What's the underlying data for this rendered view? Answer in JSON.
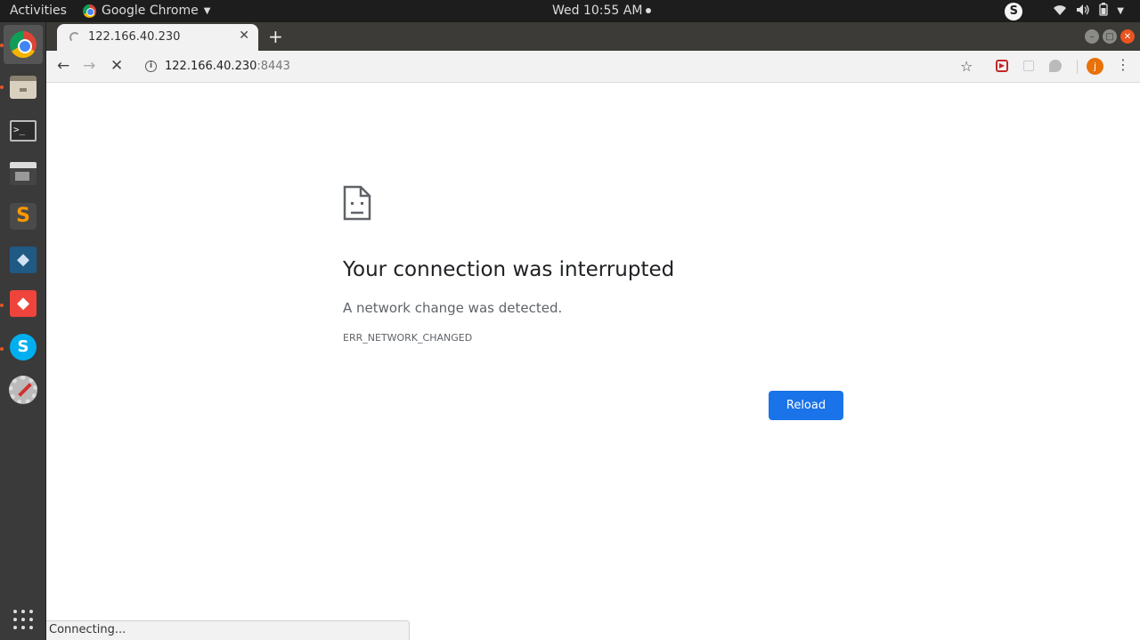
{
  "topbar": {
    "activities": "Activities",
    "app_name": "Google Chrome",
    "clock": "Wed 10:55 AM"
  },
  "browser": {
    "tab_title": "122.166.40.230",
    "url_host": "122.166.40.230",
    "url_port": ":8443",
    "profile_initial": "j"
  },
  "error_page": {
    "title": "Your connection was interrupted",
    "description": "A network change was detected.",
    "code": "ERR_NETWORK_CHANGED",
    "reload_label": "Reload"
  },
  "status_bar": {
    "text": "Connecting..."
  },
  "colors": {
    "accent_blue": "#1a73e8",
    "ubuntu_orange": "#e95420"
  },
  "icons": {
    "dock": [
      "chrome-icon",
      "files-icon",
      "terminal-icon",
      "video-editor-icon",
      "sublime-text-icon",
      "mysql-workbench-icon",
      "anydesk-icon",
      "skype-icon",
      "system-tools-icon",
      "show-apps-icon"
    ]
  }
}
